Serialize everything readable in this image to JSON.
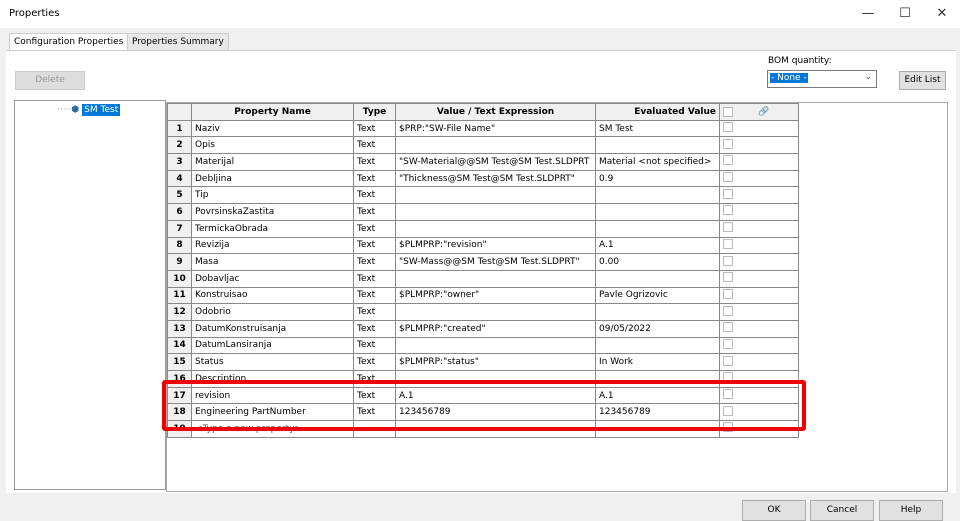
{
  "window": {
    "title": "Properties",
    "minimize": "—",
    "maximize": "☐",
    "close": "✕"
  },
  "tabs": [
    {
      "label": "Configuration Properties",
      "active": true
    },
    {
      "label": "Properties Summary",
      "active": false
    }
  ],
  "delete_label": "Delete",
  "bom": {
    "label": "BOM quantity:",
    "value": "- None -",
    "edit_list": "Edit List"
  },
  "tree": {
    "item": "SM Test",
    "icon": "part-icon"
  },
  "grid": {
    "headers": [
      "Property Name",
      "Type",
      "Value / Text Expression",
      "Evaluated Value",
      "🔗"
    ],
    "rows": [
      [
        "1",
        "Naziv",
        "Text",
        "$PRP:\"SW-File Name\"",
        "SM Test"
      ],
      [
        "2",
        "Opis",
        "Text",
        "",
        ""
      ],
      [
        "3",
        "Materijal",
        "Text",
        "\"SW-Material@@SM Test@SM Test.SLDPRT",
        "Material <not specified>"
      ],
      [
        "4",
        "Debljina",
        "Text",
        "\"Thickness@SM Test@SM Test.SLDPRT\"",
        "0.9"
      ],
      [
        "5",
        "Tip",
        "Text",
        "",
        ""
      ],
      [
        "6",
        "PovrsinskaZastita",
        "Text",
        "",
        ""
      ],
      [
        "7",
        "TermickaObrada",
        "Text",
        "",
        ""
      ],
      [
        "8",
        "Revizija",
        "Text",
        "$PLMPRP:\"revision\"",
        "A.1"
      ],
      [
        "9",
        "Masa",
        "Text",
        "\"SW-Mass@@SM Test@SM Test.SLDPRT\"",
        "0.00"
      ],
      [
        "10",
        "Dobavljac",
        "Text",
        "",
        ""
      ],
      [
        "11",
        "Konstruisao",
        "Text",
        "$PLMPRP:\"owner\"",
        "Pavle Ogrizovic"
      ],
      [
        "12",
        "Odobrio",
        "Text",
        "",
        ""
      ],
      [
        "13",
        "DatumKonstruisanja",
        "Text",
        "$PLMPRP:\"created\"",
        "09/05/2022"
      ],
      [
        "14",
        "DatumLansiranja",
        "Text",
        "",
        ""
      ],
      [
        "15",
        "Status",
        "Text",
        "$PLMPRP:\"status\"",
        "In Work"
      ],
      [
        "16",
        "Description",
        "Text",
        "",
        ""
      ],
      [
        "17",
        "revision",
        "Text",
        "A.1",
        "A.1"
      ],
      [
        "18",
        "Engineering PartNumber",
        "Text",
        "123456789",
        "123456789"
      ],
      [
        "19",
        "<Type a new property>",
        "",
        "",
        ""
      ]
    ]
  },
  "footer": {
    "ok": "OK",
    "cancel": "Cancel",
    "help": "Help"
  },
  "highlight_color": "#e00000"
}
